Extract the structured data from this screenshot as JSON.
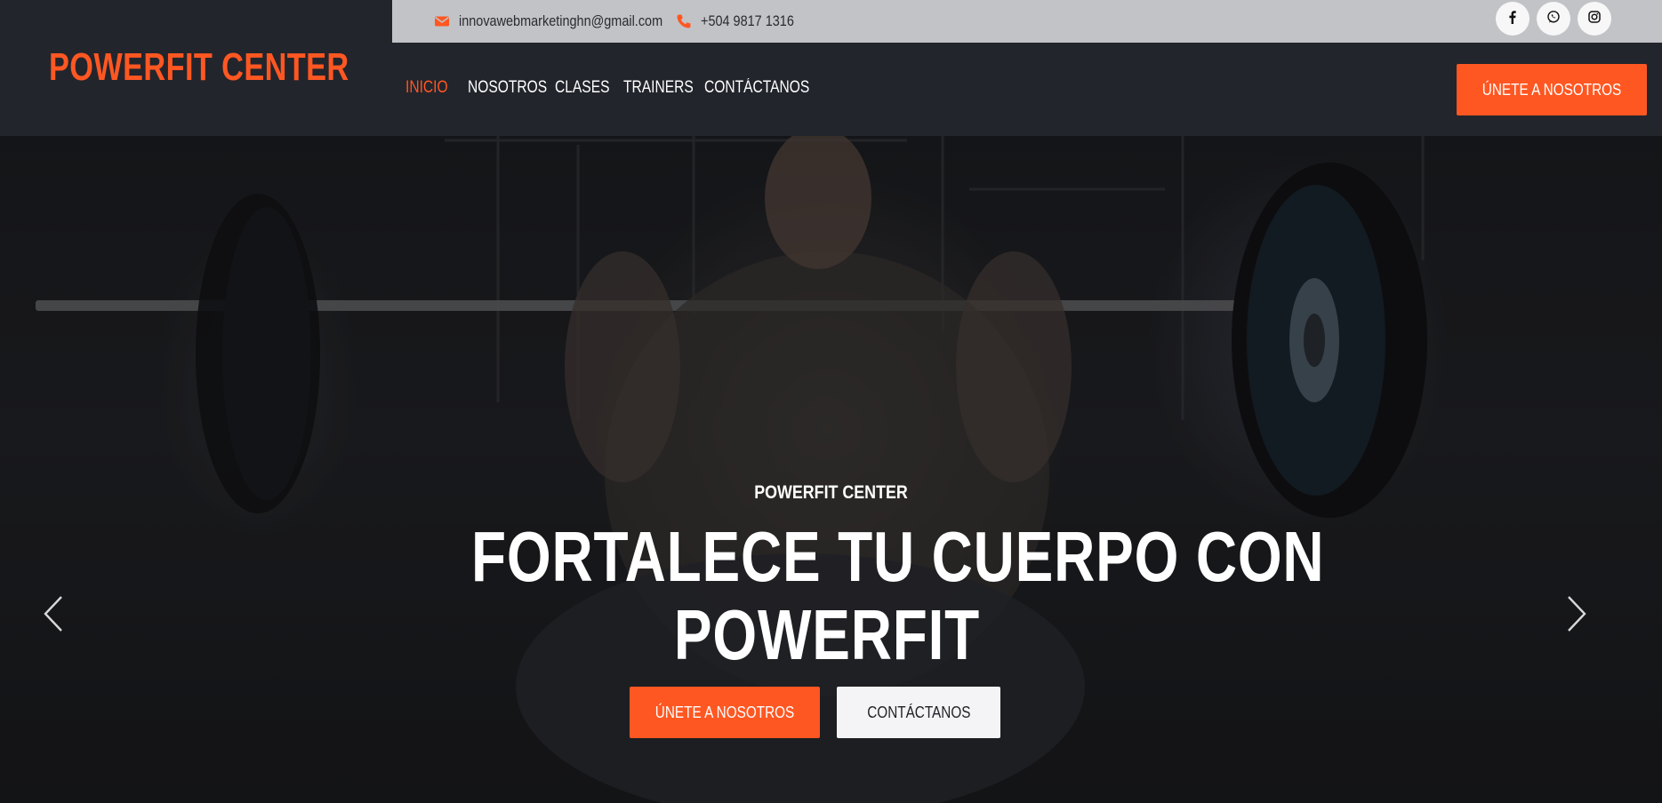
{
  "brand": {
    "name": "POWERFIT CENTER"
  },
  "topbar": {
    "email": "innovawebmarketinghn@gmail.com",
    "phone": "+504 9817 1316"
  },
  "nav": {
    "items": [
      {
        "label": "INICIO",
        "active": true
      },
      {
        "label": "NOSOTROS",
        "active": false
      },
      {
        "label": "CLASES",
        "active": false
      },
      {
        "label": "TRAINERS",
        "active": false
      },
      {
        "label": "CONTÁCTANOS",
        "active": false
      }
    ],
    "cta_label": "ÚNETE A NOSOTROS"
  },
  "hero": {
    "subtitle": "POWERFIT CENTER",
    "title_line1": "FORTALECE TU CUERPO CON",
    "title_line2": "POWERFIT",
    "primary_button": "ÚNETE A NOSOTROS",
    "secondary_button": "CONTÁCTANOS"
  },
  "icons": {
    "email": "envelope-icon",
    "phone": "phone-icon",
    "social": [
      "facebook-icon",
      "whatsapp-icon",
      "instagram-icon"
    ],
    "carousel": [
      "chevron-left-icon",
      "chevron-right-icon"
    ]
  },
  "colors": {
    "accent": "#ff5722",
    "header_bg": "#23252c",
    "topbar_bg": "#c2c3c7"
  }
}
